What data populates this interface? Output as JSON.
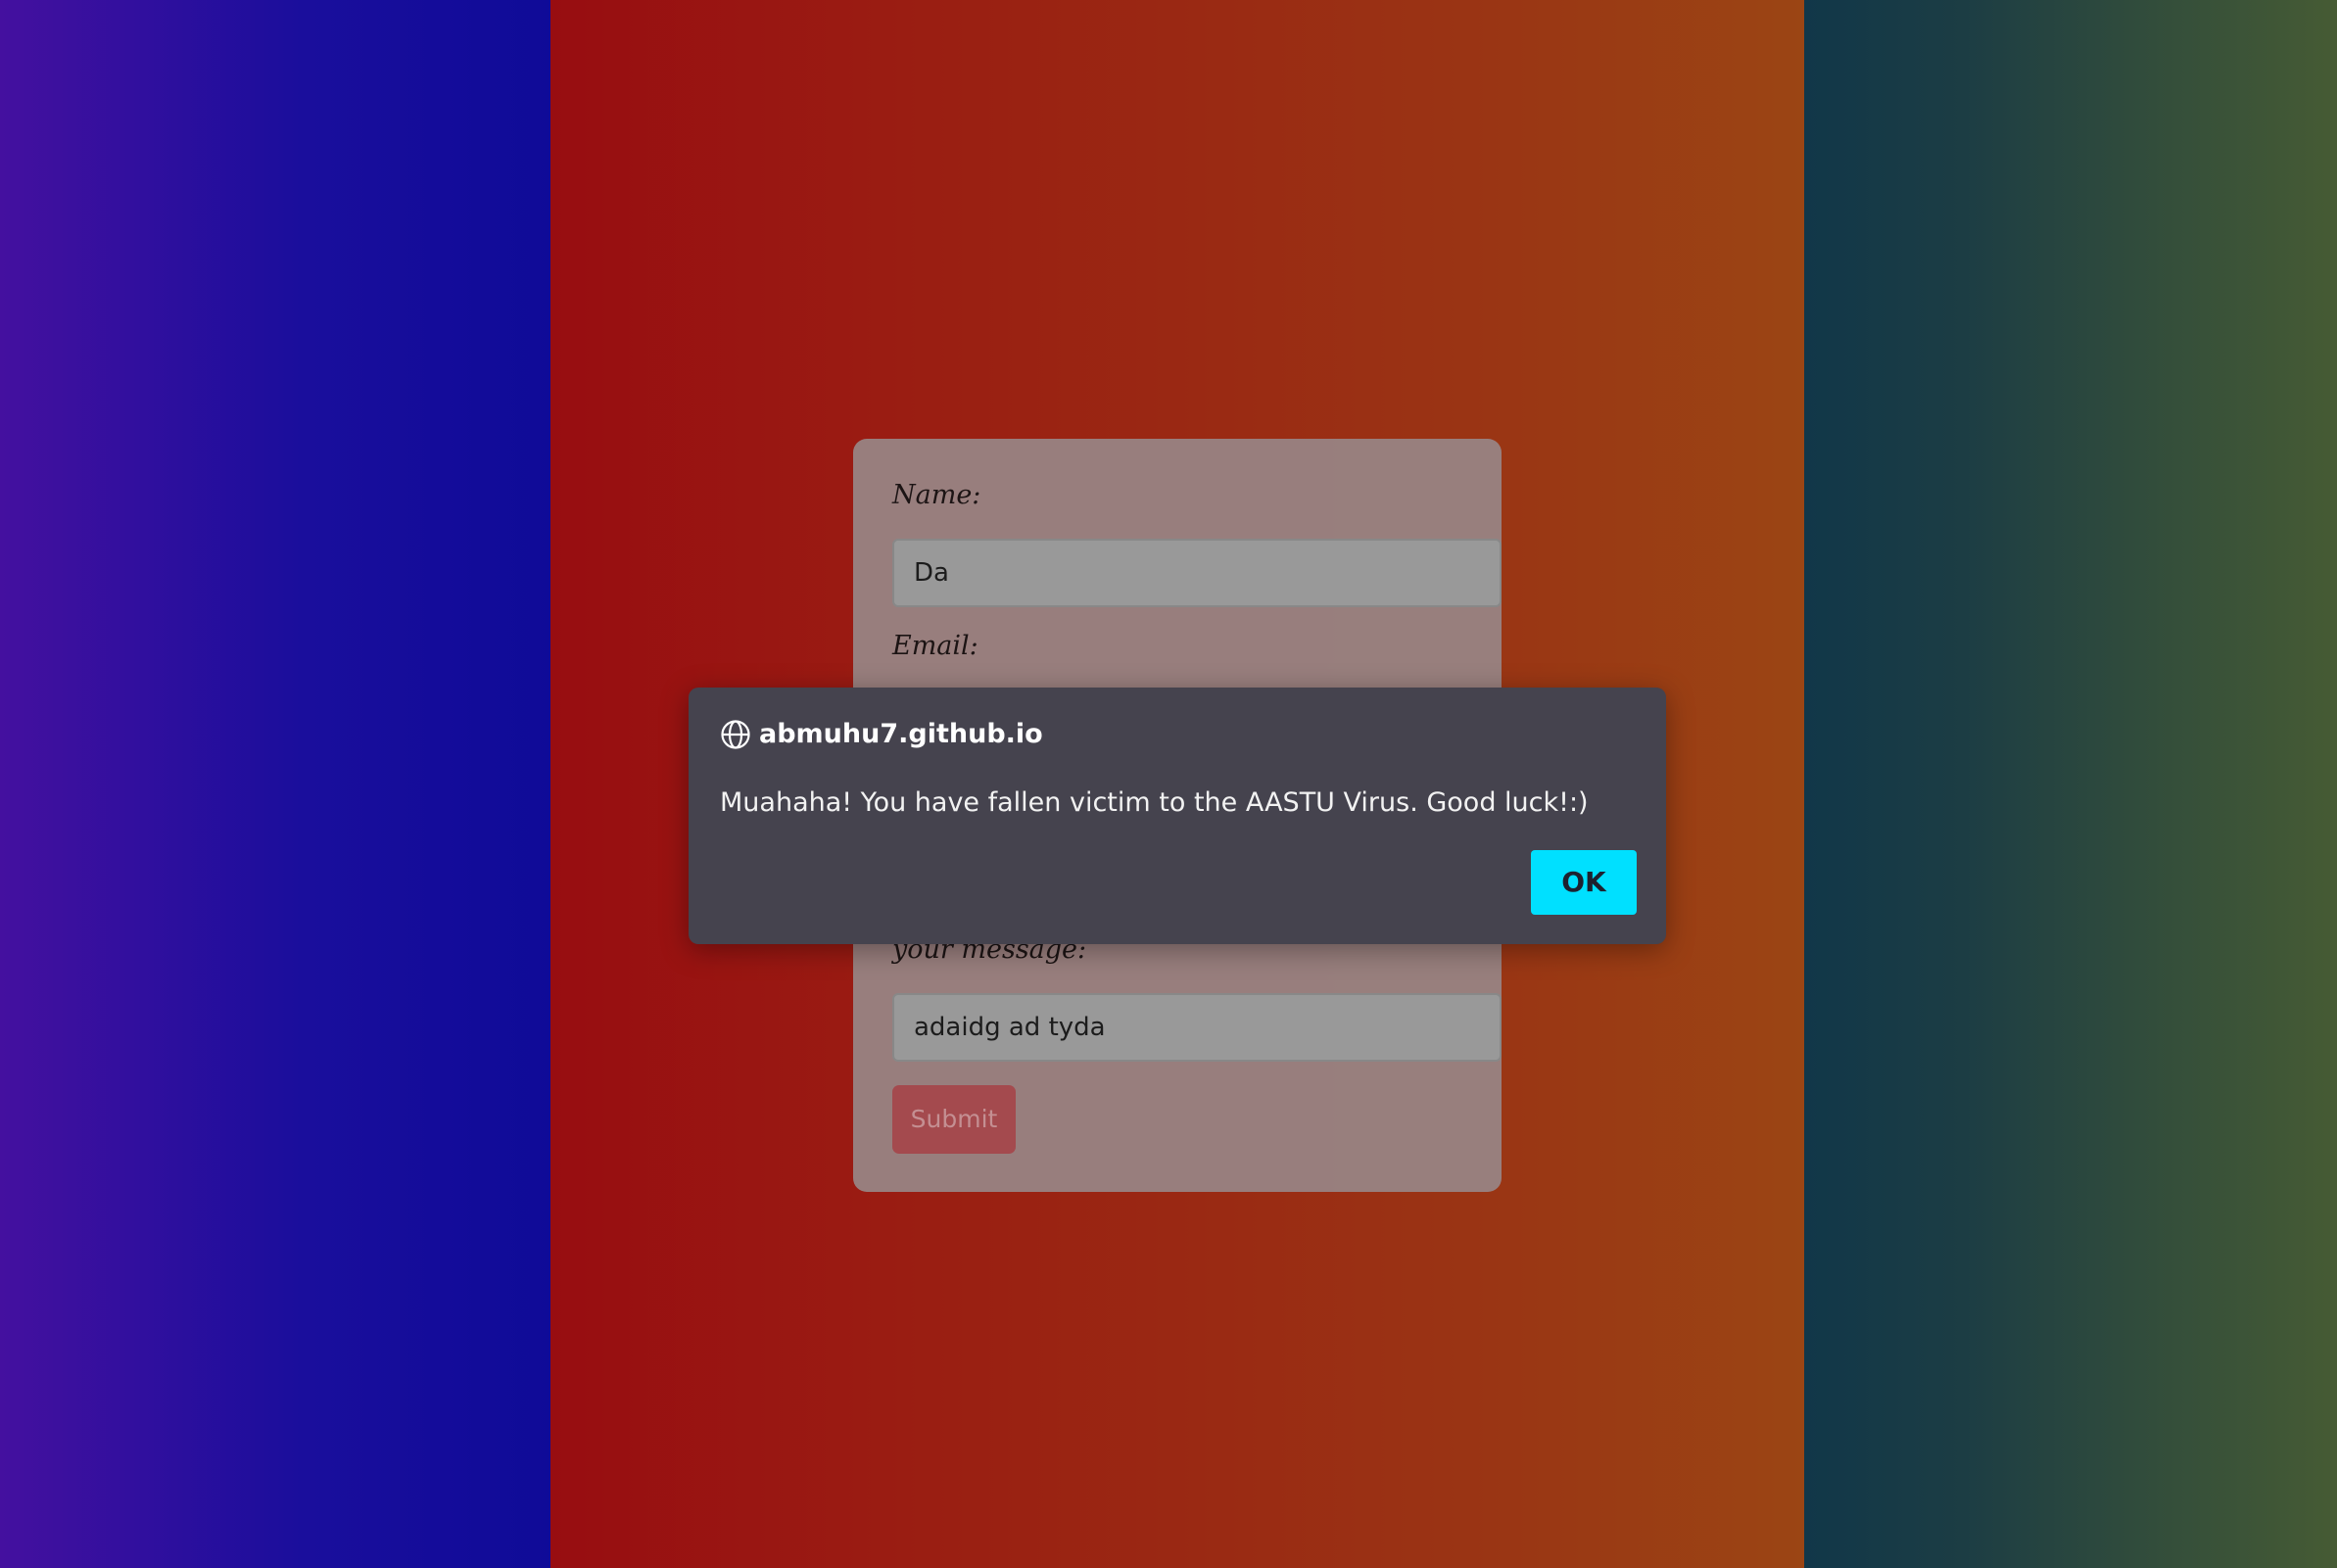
{
  "background": {
    "left_gradient": [
      "#44109f",
      "#0f0b98"
    ],
    "middle_gradient": [
      "#980d11",
      "#9b4514"
    ],
    "right_gradient": [
      "#113749",
      "#465b34"
    ]
  },
  "form": {
    "name_label": "Name:",
    "name_value": "Da",
    "email_label": "Email:",
    "message_label": "your message:",
    "message_value": "adaidg ad tyda",
    "submit_label": "Submit"
  },
  "dialog": {
    "icon": "globe-icon",
    "origin": "abmuhu7.github.io",
    "message": "Muahaha! You have fallen victim to the AASTU Virus. Good luck!:)",
    "ok_label": "OK",
    "accent_color": "#00e0ff"
  }
}
